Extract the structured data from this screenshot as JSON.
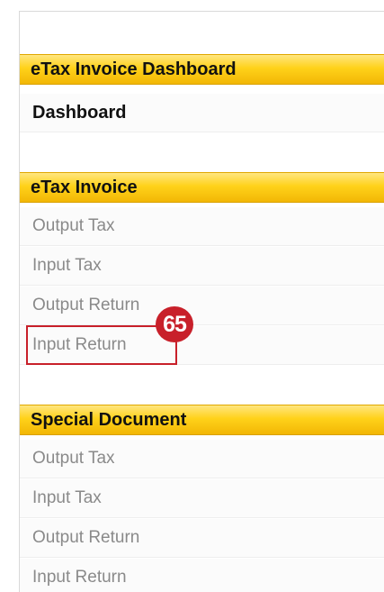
{
  "sections": [
    {
      "title": "eTax Invoice Dashboard",
      "items": [
        {
          "label": "Dashboard"
        }
      ]
    },
    {
      "title": "eTax Invoice",
      "items": [
        {
          "label": "Output Tax"
        },
        {
          "label": "Input Tax"
        },
        {
          "label": "Output Return"
        },
        {
          "label": "Input Return"
        }
      ]
    },
    {
      "title": "Special Document",
      "items": [
        {
          "label": "Output Tax"
        },
        {
          "label": "Input Tax"
        },
        {
          "label": "Output Return"
        },
        {
          "label": "Input Return"
        }
      ]
    }
  ],
  "annotation": {
    "step_number": "65",
    "color": "#c8202a"
  },
  "colors": {
    "header_gradient_top": "#ffe680",
    "header_gradient_bottom": "#f2b705",
    "item_text": "#8a8a8a"
  }
}
